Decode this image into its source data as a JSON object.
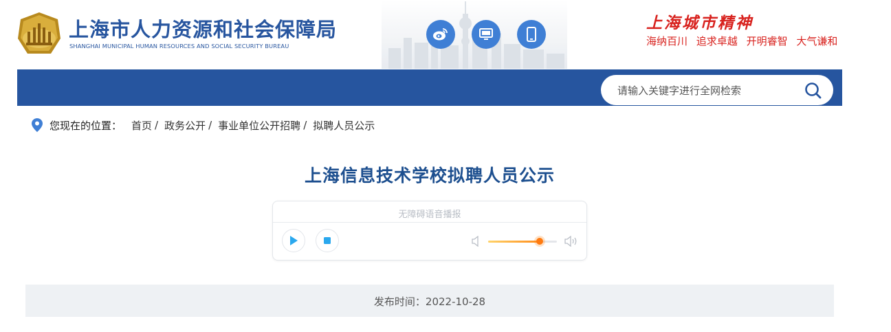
{
  "header": {
    "title_cn": "上海市人力资源和社会保障局",
    "title_en": "SHANGHAI MUNICIPAL HUMAN RESOURCES AND SOCIAL SECURITY BUREAU",
    "social_icons": [
      "weibo-icon",
      "desktop-icon",
      "mobile-icon"
    ],
    "spirit_title": "上海城市精神",
    "spirit_items": [
      "海纳百川",
      "追求卓越",
      "开明睿智",
      "大气谦和"
    ]
  },
  "search": {
    "placeholder": "请输入关键字进行全网检索"
  },
  "breadcrumb": {
    "label": "您现在的位置：",
    "items": [
      "首页",
      "政务公开",
      "事业单位公开招聘",
      "拟聘人员公示"
    ],
    "separator": "/"
  },
  "article": {
    "title": "上海信息技术学校拟聘人员公示",
    "publish_label": "发布时间：2022-10-28"
  },
  "player": {
    "label": "无障碍语音播报",
    "volume_fraction": 0.75
  },
  "colors": {
    "brand_blue": "#26559f",
    "title_blue": "#1d4f8f",
    "accent_red": "#d8221e",
    "icon_blue": "#3f7fd5",
    "volume_orange": "#ff7a10"
  }
}
